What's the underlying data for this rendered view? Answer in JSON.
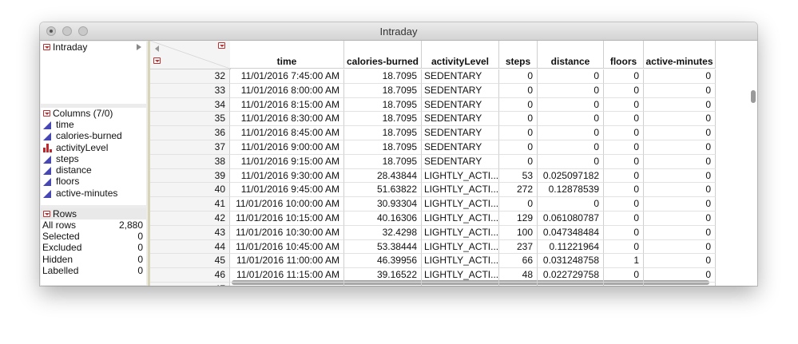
{
  "window": {
    "title": "Intraday"
  },
  "table_panel": {
    "label": "Intraday"
  },
  "columns_panel": {
    "header": "Columns (7/0)",
    "items": [
      {
        "name": "time",
        "type": "continuous"
      },
      {
        "name": "calories-burned",
        "type": "continuous"
      },
      {
        "name": "activityLevel",
        "type": "nominal"
      },
      {
        "name": "steps",
        "type": "continuous"
      },
      {
        "name": "distance",
        "type": "continuous"
      },
      {
        "name": "floors",
        "type": "continuous"
      },
      {
        "name": "active-minutes",
        "type": "continuous"
      }
    ]
  },
  "rows_panel": {
    "header": "Rows",
    "items": [
      {
        "label": "All rows",
        "value": "2,880"
      },
      {
        "label": "Selected",
        "value": "0"
      },
      {
        "label": "Excluded",
        "value": "0"
      },
      {
        "label": "Hidden",
        "value": "0"
      },
      {
        "label": "Labelled",
        "value": "0"
      }
    ]
  },
  "grid": {
    "headers": [
      "time",
      "calories-burned",
      "activityLevel",
      "steps",
      "distance",
      "floors",
      "active-minutes"
    ],
    "rows": [
      {
        "n": "32",
        "cells": [
          "11/01/2016 7:45:00 AM",
          "18.7095",
          "SEDENTARY",
          "0",
          "0",
          "0",
          "0"
        ]
      },
      {
        "n": "33",
        "cells": [
          "11/01/2016 8:00:00 AM",
          "18.7095",
          "SEDENTARY",
          "0",
          "0",
          "0",
          "0"
        ]
      },
      {
        "n": "34",
        "cells": [
          "11/01/2016 8:15:00 AM",
          "18.7095",
          "SEDENTARY",
          "0",
          "0",
          "0",
          "0"
        ]
      },
      {
        "n": "35",
        "cells": [
          "11/01/2016 8:30:00 AM",
          "18.7095",
          "SEDENTARY",
          "0",
          "0",
          "0",
          "0"
        ]
      },
      {
        "n": "36",
        "cells": [
          "11/01/2016 8:45:00 AM",
          "18.7095",
          "SEDENTARY",
          "0",
          "0",
          "0",
          "0"
        ]
      },
      {
        "n": "37",
        "cells": [
          "11/01/2016 9:00:00 AM",
          "18.7095",
          "SEDENTARY",
          "0",
          "0",
          "0",
          "0"
        ]
      },
      {
        "n": "38",
        "cells": [
          "11/01/2016 9:15:00 AM",
          "18.7095",
          "SEDENTARY",
          "0",
          "0",
          "0",
          "0"
        ]
      },
      {
        "n": "39",
        "cells": [
          "11/01/2016 9:30:00 AM",
          "28.43844",
          "LIGHTLY_ACTI...",
          "53",
          "0.025097182",
          "0",
          "0"
        ]
      },
      {
        "n": "40",
        "cells": [
          "11/01/2016 9:45:00 AM",
          "51.63822",
          "LIGHTLY_ACTI...",
          "272",
          "0.12878539",
          "0",
          "0"
        ]
      },
      {
        "n": "41",
        "cells": [
          "11/01/2016 10:00:00 AM",
          "30.93304",
          "LIGHTLY_ACTI...",
          "0",
          "0",
          "0",
          "0"
        ]
      },
      {
        "n": "42",
        "cells": [
          "11/01/2016 10:15:00 AM",
          "40.16306",
          "LIGHTLY_ACTI...",
          "129",
          "0.061080787",
          "0",
          "0"
        ]
      },
      {
        "n": "43",
        "cells": [
          "11/01/2016 10:30:00 AM",
          "32.4298",
          "LIGHTLY_ACTI...",
          "100",
          "0.047348484",
          "0",
          "0"
        ]
      },
      {
        "n": "44",
        "cells": [
          "11/01/2016 10:45:00 AM",
          "53.38444",
          "LIGHTLY_ACTI...",
          "237",
          "0.11221964",
          "0",
          "0"
        ]
      },
      {
        "n": "45",
        "cells": [
          "11/01/2016 11:00:00 AM",
          "46.39956",
          "LIGHTLY_ACTI...",
          "66",
          "0.031248758",
          "1",
          "0"
        ]
      },
      {
        "n": "46",
        "cells": [
          "11/01/2016 11:15:00 AM",
          "39.16522",
          "LIGHTLY_ACTI...",
          "48",
          "0.022729758",
          "0",
          "0"
        ]
      },
      {
        "n": "47",
        "cells": [
          "",
          "",
          "",
          "",
          "",
          "",
          ""
        ]
      }
    ]
  }
}
